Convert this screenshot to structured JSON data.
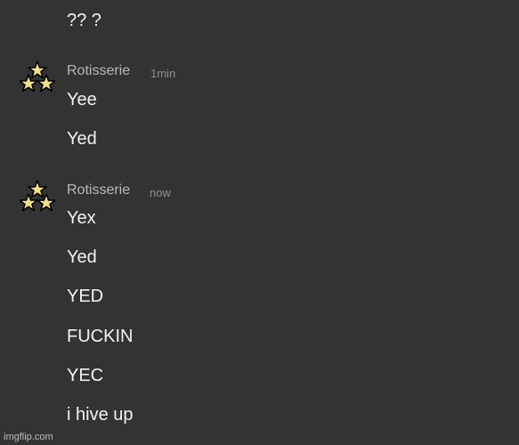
{
  "orphan_message": "?? ?",
  "groups": [
    {
      "username": "Rotisserie",
      "timestamp": "1min",
      "avatar_icon": "three-stars-icon",
      "messages": [
        "Yee",
        "Yed"
      ]
    },
    {
      "username": "Rotisserie",
      "timestamp": "now",
      "avatar_icon": "three-stars-icon",
      "messages": [
        "Yex",
        "Yed",
        "YED",
        "FUCKIN",
        "YEC",
        "i hive up"
      ]
    }
  ],
  "watermark": "imgflip.com",
  "colors": {
    "background": "#333333",
    "message_text": "#f2f2f2",
    "username": "#b8b8b8",
    "timestamp": "#8e8e8e",
    "star_fill": "#f0e08a"
  }
}
